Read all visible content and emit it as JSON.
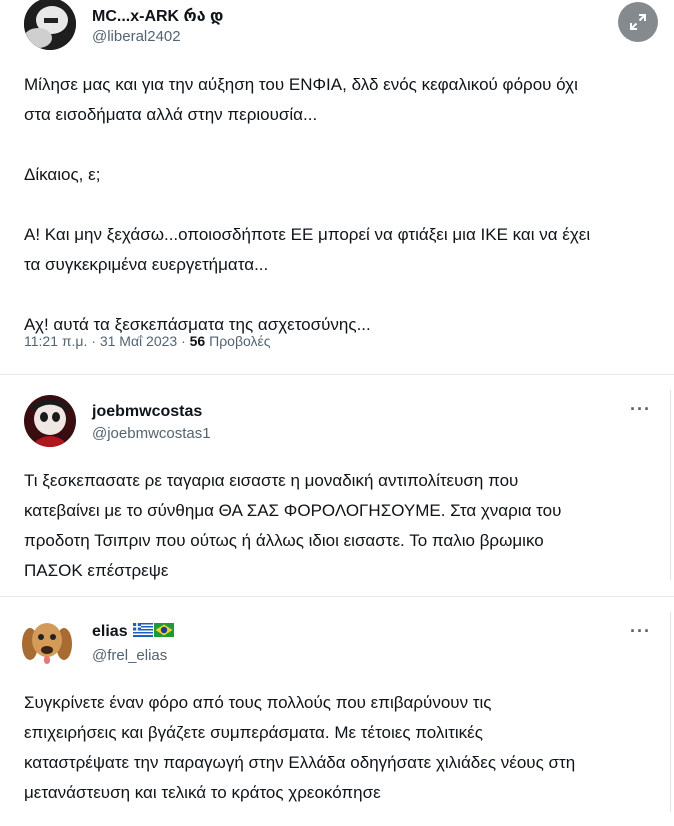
{
  "tweet1": {
    "name": "MC...x-ARK რა დ",
    "handle": "@liberal2402",
    "paragraphs": [
      "Μίλησε μας και για την αύξηση του ΕΝΦΙΑ, δλδ ενός κεφαλικού φόρου όχι",
      "στα εισοδήματα αλλά στην περιουσία...",
      "Δίκαιος, ε;",
      "Α! Και μην ξεχάσω...οποιοσδήποτε ΕΕ μπορεί να φτιάξει μια ΙΚΕ και να έχει",
      "τα συγκεκριμένα ευεργετήματα...",
      "Αχ! αυτά τα ξεσκεπάσματα της ασχετοσύνης..."
    ],
    "timestamp": "11:21 π.μ. · 31 Μαΐ 2023 · ",
    "views_count": "56",
    "views_label": " Προβολές"
  },
  "tweet2": {
    "name": "joebmwcostas",
    "handle": "@joebmwcostas1",
    "lines": [
      "Τι ξεσκεπασατε ρε ταγαρια εισαστε η μοναδική αντιπολίτευση που",
      "κατεβαίνει με το σύνθημα ΘΑ ΣΑΣ ΦΟΡΟΛΟΓΗΣΟΥΜΕ. Στα χναρια του",
      "προδοτη Τσιπριν που ούτως ή άλλως ιδιοι εισαστε. Το παλιο βρωμικο",
      "ΠΑΣΟΚ επέστρεψε"
    ],
    "more": "···"
  },
  "tweet3": {
    "name": "elias",
    "handle": "@frel_elias",
    "lines": [
      "Συγκρίνετε έναν φόρο από τους πολλούς που επιβαρύνουν τις",
      "επιχειρήσεις και βγάζετε συμπεράσματα. Με τέτοιες πολιτικές",
      "καταστρέψατε την παραγωγή στην Ελλάδα οδηγήσατε χιλιάδες νέους στη",
      "μετανάστευση και τελικά το κράτος χρεοκόπησε"
    ],
    "more": "···",
    "flags": [
      "greece-flag",
      "brazil-flag"
    ]
  }
}
